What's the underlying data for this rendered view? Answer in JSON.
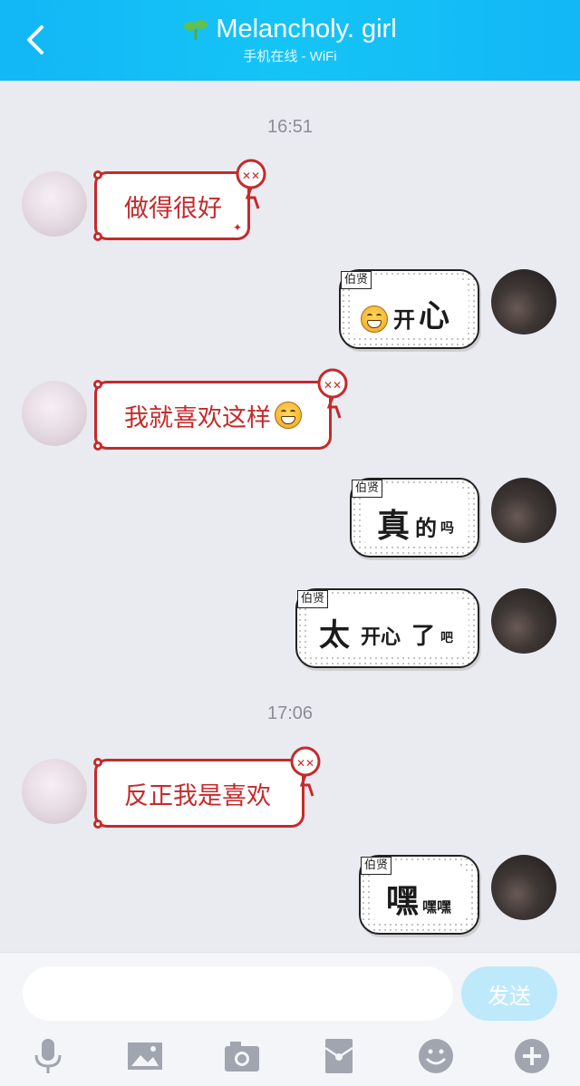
{
  "header": {
    "title": "Melancholy. girl",
    "status": "手机在线 - WiFi"
  },
  "messages": {
    "time1": "16:51",
    "m1": "做得很好",
    "m2_tag": "伯贤",
    "m2_a": "开",
    "m2_b": "心",
    "m3": "我就喜欢这样",
    "m4_tag": "伯贤",
    "m4_a": "真",
    "m4_b": "的",
    "m4_c": "吗",
    "m5_tag": "伯贤",
    "m5_a": "太",
    "m5_b": "开心",
    "m5_c": "了",
    "m5_d": "吧",
    "time2": "17:06",
    "m6": "反正我是喜欢",
    "m7_tag": "伯贤",
    "m7_a": "嘿",
    "m7_b": "嘿嘿"
  },
  "input": {
    "value": "",
    "send_label": "发送"
  },
  "toolbar": {
    "icons": [
      "microphone-icon",
      "image-icon",
      "camera-icon",
      "red-packet-icon",
      "emoji-icon",
      "plus-icon"
    ]
  },
  "colors": {
    "header": "#12b7f5",
    "red_bubble": "#c62a2a",
    "send_button": "#bde9fa",
    "background": "#e9ebf1"
  }
}
